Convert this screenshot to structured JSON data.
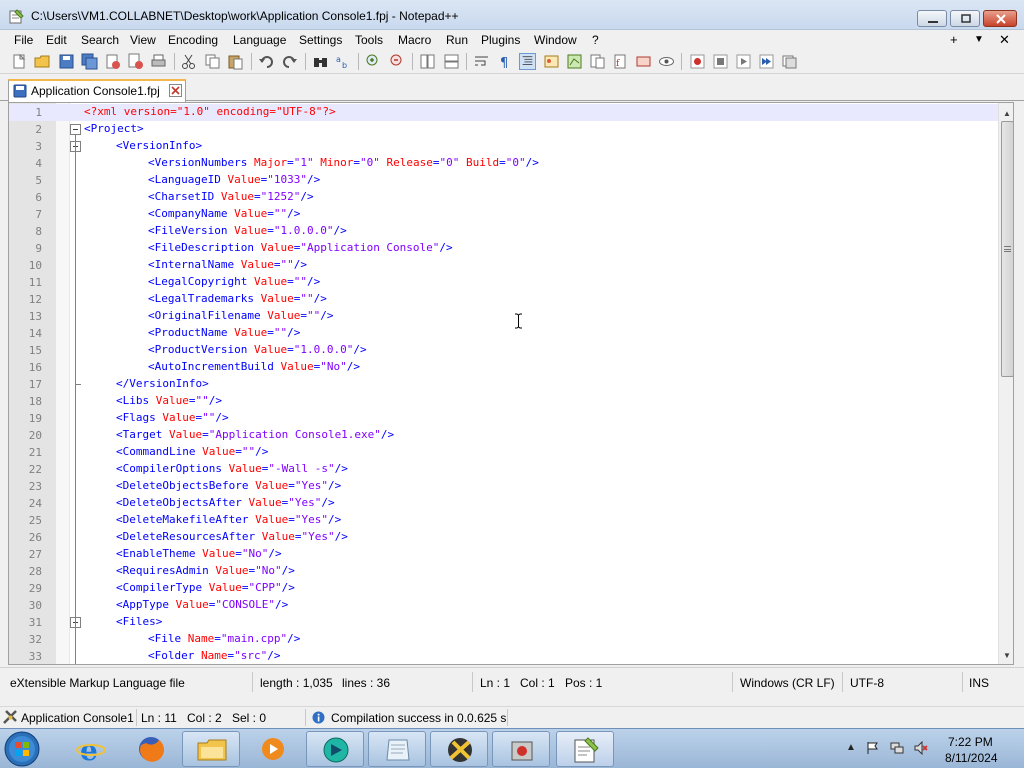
{
  "window": {
    "title": "C:\\Users\\VM1.COLLABNET\\Desktop\\work\\Application Console1.fpj - Notepad++"
  },
  "menu": {
    "items": [
      "File",
      "Edit",
      "Search",
      "View",
      "Encoding",
      "Language",
      "Settings",
      "Tools",
      "Macro",
      "Run",
      "Plugins",
      "Window",
      "?"
    ],
    "right": [
      "+",
      "▼",
      "✕"
    ]
  },
  "tab": {
    "label": "Application Console1.fpj"
  },
  "editor": {
    "lines": [
      {
        "n": "1",
        "indent": 0,
        "kind": "decl",
        "raw": "<?xml version=\"1.0\" encoding=\"UTF-8\"?>"
      },
      {
        "n": "2",
        "indent": 0,
        "kind": "open",
        "tag": "Project"
      },
      {
        "n": "3",
        "indent": 1,
        "kind": "open",
        "tag": "VersionInfo"
      },
      {
        "n": "4",
        "indent": 2,
        "kind": "self",
        "tag": "VersionNumbers",
        "attrs": [
          [
            "Major",
            "1"
          ],
          [
            "Minor",
            "0"
          ],
          [
            "Release",
            "0"
          ],
          [
            "Build",
            "0"
          ]
        ]
      },
      {
        "n": "5",
        "indent": 2,
        "kind": "self",
        "tag": "LanguageID",
        "attrs": [
          [
            "Value",
            "1033"
          ]
        ]
      },
      {
        "n": "6",
        "indent": 2,
        "kind": "self",
        "tag": "CharsetID",
        "attrs": [
          [
            "Value",
            "1252"
          ]
        ]
      },
      {
        "n": "7",
        "indent": 2,
        "kind": "self",
        "tag": "CompanyName",
        "attrs": [
          [
            "Value",
            ""
          ]
        ]
      },
      {
        "n": "8",
        "indent": 2,
        "kind": "self",
        "tag": "FileVersion",
        "attrs": [
          [
            "Value",
            "1.0.0.0"
          ]
        ]
      },
      {
        "n": "9",
        "indent": 2,
        "kind": "self",
        "tag": "FileDescription",
        "attrs": [
          [
            "Value",
            "Application Console"
          ]
        ]
      },
      {
        "n": "10",
        "indent": 2,
        "kind": "self",
        "tag": "InternalName",
        "attrs": [
          [
            "Value",
            ""
          ]
        ]
      },
      {
        "n": "11",
        "indent": 2,
        "kind": "self",
        "tag": "LegalCopyright",
        "attrs": [
          [
            "Value",
            ""
          ]
        ]
      },
      {
        "n": "12",
        "indent": 2,
        "kind": "self",
        "tag": "LegalTrademarks",
        "attrs": [
          [
            "Value",
            ""
          ]
        ]
      },
      {
        "n": "13",
        "indent": 2,
        "kind": "self",
        "tag": "OriginalFilename",
        "attrs": [
          [
            "Value",
            ""
          ]
        ]
      },
      {
        "n": "14",
        "indent": 2,
        "kind": "self",
        "tag": "ProductName",
        "attrs": [
          [
            "Value",
            ""
          ]
        ]
      },
      {
        "n": "15",
        "indent": 2,
        "kind": "self",
        "tag": "ProductVersion",
        "attrs": [
          [
            "Value",
            "1.0.0.0"
          ]
        ]
      },
      {
        "n": "16",
        "indent": 2,
        "kind": "self",
        "tag": "AutoIncrementBuild",
        "attrs": [
          [
            "Value",
            "No"
          ]
        ]
      },
      {
        "n": "17",
        "indent": 1,
        "kind": "close",
        "tag": "VersionInfo"
      },
      {
        "n": "18",
        "indent": 1,
        "kind": "self",
        "tag": "Libs",
        "attrs": [
          [
            "Value",
            ""
          ]
        ]
      },
      {
        "n": "19",
        "indent": 1,
        "kind": "self",
        "tag": "Flags",
        "attrs": [
          [
            "Value",
            ""
          ]
        ]
      },
      {
        "n": "20",
        "indent": 1,
        "kind": "self",
        "tag": "Target",
        "attrs": [
          [
            "Value",
            "Application Console1.exe"
          ]
        ]
      },
      {
        "n": "21",
        "indent": 1,
        "kind": "self",
        "tag": "CommandLine",
        "attrs": [
          [
            "Value",
            ""
          ]
        ]
      },
      {
        "n": "22",
        "indent": 1,
        "kind": "self",
        "tag": "CompilerOptions",
        "attrs": [
          [
            "Value",
            "-Wall -s"
          ]
        ]
      },
      {
        "n": "23",
        "indent": 1,
        "kind": "self",
        "tag": "DeleteObjectsBefore",
        "attrs": [
          [
            "Value",
            "Yes"
          ]
        ]
      },
      {
        "n": "24",
        "indent": 1,
        "kind": "self",
        "tag": "DeleteObjectsAfter",
        "attrs": [
          [
            "Value",
            "Yes"
          ]
        ]
      },
      {
        "n": "25",
        "indent": 1,
        "kind": "self",
        "tag": "DeleteMakefileAfter",
        "attrs": [
          [
            "Value",
            "Yes"
          ]
        ]
      },
      {
        "n": "26",
        "indent": 1,
        "kind": "self",
        "tag": "DeleteResourcesAfter",
        "attrs": [
          [
            "Value",
            "Yes"
          ]
        ]
      },
      {
        "n": "27",
        "indent": 1,
        "kind": "self",
        "tag": "EnableTheme",
        "attrs": [
          [
            "Value",
            "No"
          ]
        ]
      },
      {
        "n": "28",
        "indent": 1,
        "kind": "self",
        "tag": "RequiresAdmin",
        "attrs": [
          [
            "Value",
            "No"
          ]
        ]
      },
      {
        "n": "29",
        "indent": 1,
        "kind": "self",
        "tag": "CompilerType",
        "attrs": [
          [
            "Value",
            "CPP"
          ]
        ]
      },
      {
        "n": "30",
        "indent": 1,
        "kind": "self",
        "tag": "AppType",
        "attrs": [
          [
            "Value",
            "CONSOLE"
          ]
        ]
      },
      {
        "n": "31",
        "indent": 1,
        "kind": "open",
        "tag": "Files"
      },
      {
        "n": "32",
        "indent": 2,
        "kind": "self",
        "tag": "File",
        "attrs": [
          [
            "Name",
            "main.cpp"
          ]
        ]
      },
      {
        "n": "33",
        "indent": 2,
        "kind": "self",
        "tag": "Folder",
        "attrs": [
          [
            "Name",
            "src"
          ]
        ]
      }
    ],
    "current_line": "1"
  },
  "status": {
    "filetype": "eXtensible Markup Language file",
    "length": "length : 1,035",
    "lines": "lines : 36",
    "ln": "Ln : 1",
    "col": "Col : 1",
    "pos": "Pos : 1",
    "eol": "Windows (CR LF)",
    "encoding": "UTF-8",
    "mode": "INS"
  },
  "appstrip": {
    "project": "Application Console1",
    "ln": "Ln : 11",
    "col": "Col : 2",
    "sel": "Sel : 0",
    "message": "Compilation success in 0.0.625 s"
  },
  "taskbar": {
    "time": "7:22 PM",
    "date": "8/11/2024"
  },
  "icons": {
    "app": "notepadpp-icon",
    "tab": "file-saved-icon",
    "start": "windows-start-icon"
  }
}
